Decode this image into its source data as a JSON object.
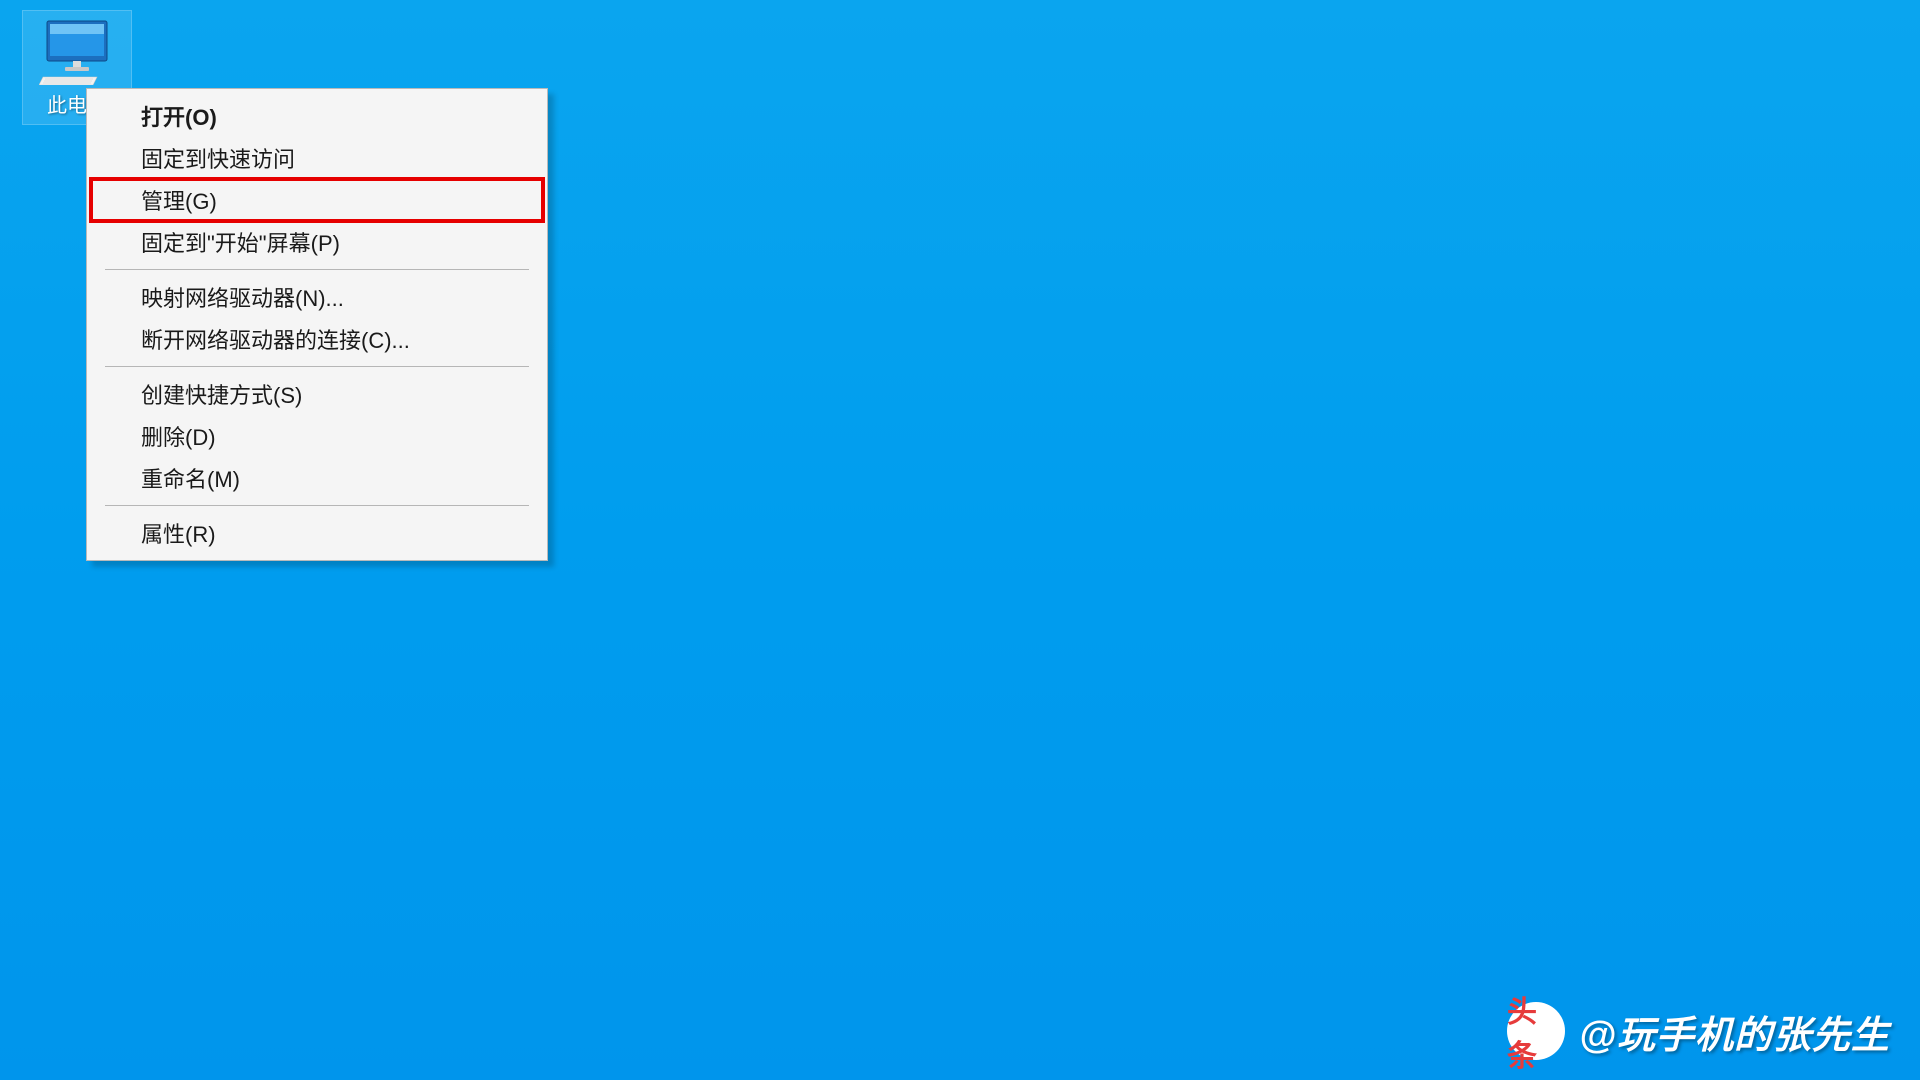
{
  "desktop": {
    "this_pc_label": "此电脑"
  },
  "context_menu": {
    "items": [
      {
        "label": "打开(O)",
        "bold": true
      },
      {
        "label": "固定到快速访问"
      },
      {
        "label": "管理(G)",
        "highlighted": true
      },
      {
        "label": "固定到\"开始\"屏幕(P)"
      },
      "sep",
      {
        "label": "映射网络驱动器(N)..."
      },
      {
        "label": "断开网络驱动器的连接(C)..."
      },
      "sep",
      {
        "label": "创建快捷方式(S)"
      },
      {
        "label": "删除(D)"
      },
      {
        "label": "重命名(M)"
      },
      "sep",
      {
        "label": "属性(R)"
      }
    ]
  },
  "watermark": {
    "logo_text": "头条",
    "author": "@玩手机的张先生"
  }
}
